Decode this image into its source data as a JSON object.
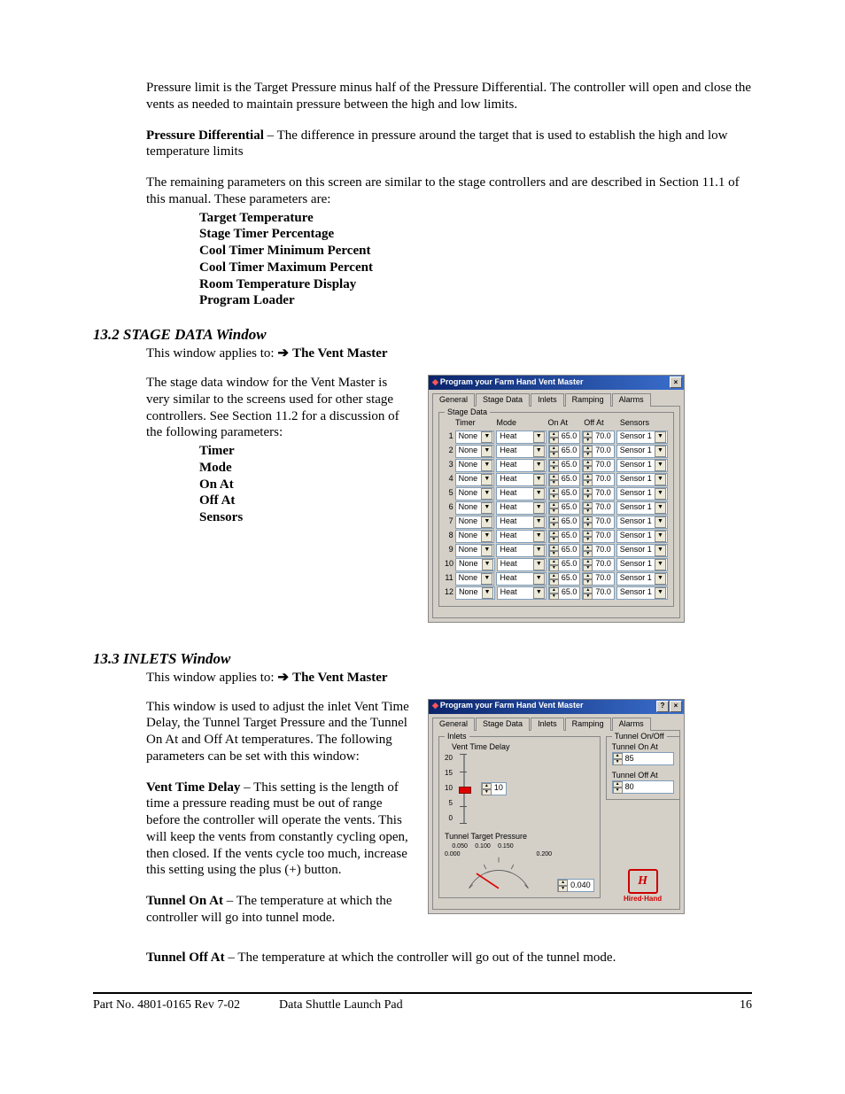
{
  "body": {
    "p1": "Pressure limit is the Target Pressure minus half of the Pressure Differential.  The controller will open and close the vents as needed to maintain pressure between the high and low limits.",
    "p2_term": "Pressure Differential",
    "p2_rest": " – The difference in pressure around the target that is used to establish the high and low temperature limits",
    "p3": "The remaining parameters on this screen are similar to the stage controllers and are described in Section 11.1 of this manual.  These parameters are:",
    "list1": [
      "Target Temperature",
      "Stage Timer Percentage",
      "Cool Timer Minimum Percent",
      "Cool Timer Maximum Percent",
      "Room Temperature Display",
      "Program Loader"
    ]
  },
  "sec132": {
    "head": "13.2  STAGE DATA Window",
    "applies_label": "This window applies to:",
    "applies_target": "The Vent Master",
    "p1": "The stage data window for the Vent Master is very similar to the screens used for other stage controllers.  See Section 11.2 for a discussion of the following parameters:",
    "list": [
      "Timer",
      "Mode",
      "On At",
      "Off At",
      "Sensors"
    ]
  },
  "sec133": {
    "head": "13.3  INLETS Window",
    "applies_label": "This window applies to:",
    "applies_target": "The Vent Master",
    "p1": "This window is used to adjust the inlet Vent Time Delay, the Tunnel Target Pressure and the Tunnel On At and Off At temperatures.  The following parameters can be set with this window:",
    "p2_term": "Vent Time Delay",
    "p2_rest": " – This setting is the length of time a pressure reading must be out of range before the controller will operate the vents.  This will keep the vents from constantly cycling open, then closed.  If the vents cycle too much, increase this setting using the plus (+) button.",
    "p3_term": "Tunnel On At",
    "p3_rest": " – The temperature at which the controller will go into tunnel mode.",
    "p4_term": "Tunnel Off At",
    "p4_rest": " – The temperature at which the controller will go out of the tunnel mode."
  },
  "win1": {
    "title": "Program your Farm Hand Vent Master",
    "tabs": [
      "General",
      "Stage Data",
      "Inlets",
      "Ramping",
      "Alarms"
    ],
    "active_tab": 1,
    "group": "Stage Data",
    "cols": [
      "Timer",
      "Mode",
      "On At",
      "Off At",
      "Sensors"
    ],
    "row": {
      "timer": "None",
      "mode": "Heat",
      "on": "65.0",
      "off": "70.0",
      "sensor": "Sensor 1"
    },
    "count": 12
  },
  "win2": {
    "title": "Program your Farm Hand Vent Master",
    "tabs": [
      "General",
      "Stage Data",
      "Inlets",
      "Ramping",
      "Alarms"
    ],
    "active_tab": 2,
    "group_inlets": "Inlets",
    "vtd_label": "Vent Time Delay",
    "vtd_ticks": [
      "20",
      "15",
      "10",
      "5",
      "0"
    ],
    "vtd_value": "10",
    "ttp_label": "Tunnel Target Pressure",
    "ttp_ticks": [
      "0.000",
      "0.050",
      "0.100",
      "0.150",
      "0.200"
    ],
    "ttp_value": "0.040",
    "group_onoff": "Tunnel On/Off",
    "on_label": "Tunnel On At",
    "on_value": "85",
    "off_label": "Tunnel Off At",
    "off_value": "80",
    "logo_text": "Hired·Hand"
  },
  "footer": {
    "left": "Part No. 4801-0165 Rev 7-02",
    "center": "Data Shuttle Launch Pad",
    "right": "16"
  }
}
